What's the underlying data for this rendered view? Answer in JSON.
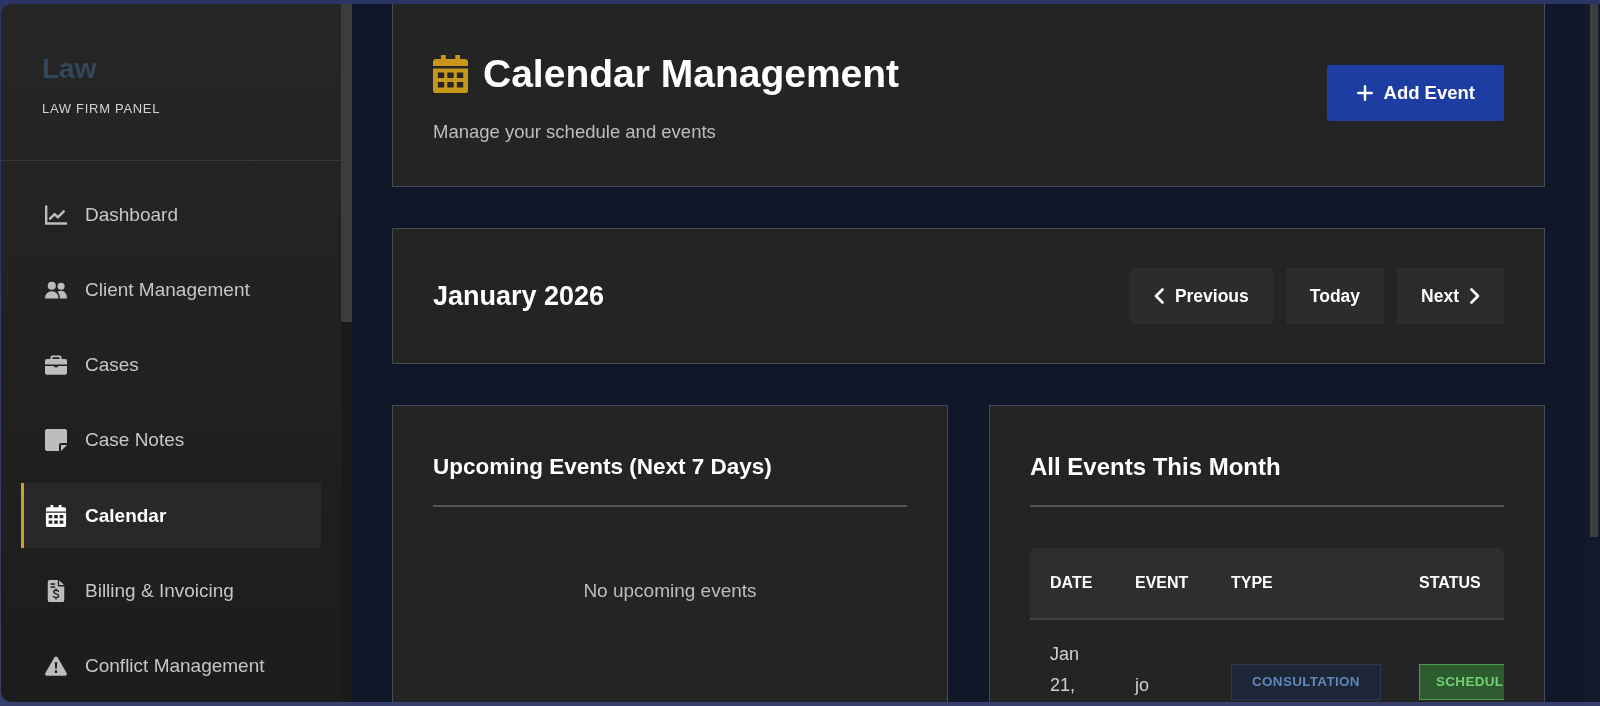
{
  "sidebar": {
    "logo": "Law",
    "subtitle": "LAW FIRM PANEL",
    "items": [
      {
        "label": "Dashboard",
        "selected": false
      },
      {
        "label": "Client Management",
        "selected": false
      },
      {
        "label": "Cases",
        "selected": false
      },
      {
        "label": "Case Notes",
        "selected": false
      },
      {
        "label": "Calendar",
        "selected": true
      },
      {
        "label": "Billing & Invoicing",
        "selected": false
      },
      {
        "label": "Conflict Management",
        "selected": false
      }
    ]
  },
  "header": {
    "title": "Calendar Management",
    "subtitle": "Manage your schedule and events",
    "button": "Add Event"
  },
  "month_nav": {
    "month": "January 2026",
    "buttons": [
      {
        "label": "Previous",
        "kind": "previous"
      },
      {
        "label": "Today",
        "kind": "plain"
      },
      {
        "label": "Next",
        "kind": "next"
      }
    ]
  },
  "upcoming": {
    "title": "Upcoming Events (Next 7 Days)",
    "empty_text": "No upcoming events"
  },
  "all_events": {
    "title": "All Events This Month",
    "table": {
      "columns": [
        "DATE",
        "EVENT",
        "TYPE",
        "STATUS"
      ],
      "rows": [
        {
          "date": "Jan 21,",
          "event": "jo",
          "type": "CONSULTATION",
          "status": "SCHEDUL"
        }
      ]
    }
  }
}
